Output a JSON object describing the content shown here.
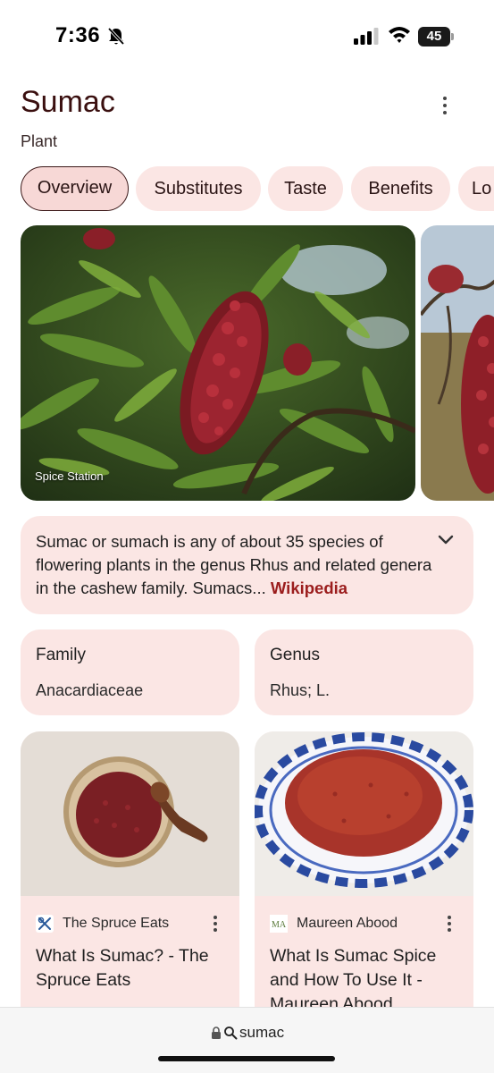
{
  "status_bar": {
    "time": "7:36",
    "battery": "45",
    "icons": [
      "bell-slash-icon",
      "signal-icon",
      "wifi-icon",
      "battery-icon"
    ]
  },
  "header": {
    "title": "Sumac",
    "subtitle": "Plant"
  },
  "tabs": [
    {
      "label": "Overview",
      "active": true
    },
    {
      "label": "Substitutes",
      "active": false
    },
    {
      "label": "Taste",
      "active": false
    },
    {
      "label": "Benefits",
      "active": false
    },
    {
      "label": "Lo",
      "active": false
    }
  ],
  "images": {
    "primary_caption": "Spice Station"
  },
  "description": {
    "text": "Sumac or sumach is any of about 35 species of flowering plants in the genus Rhus and related genera in the cashew family. Sumacs...",
    "source": "Wikipedia"
  },
  "facts": [
    {
      "label": "Family",
      "value": "Anacardiaceae"
    },
    {
      "label": "Genus",
      "value": "Rhus; L."
    }
  ],
  "articles": [
    {
      "source": "The Spruce Eats",
      "title": "What Is Sumac? - The Spruce Eats"
    },
    {
      "source": "Maureen Abood",
      "title": "What Is Sumac Spice and How To Use It - Maureen Abood",
      "source_icon_text": "MA"
    }
  ],
  "url_bar": {
    "query": "sumac"
  },
  "colors": {
    "accent_bg": "#fbe6e4",
    "title": "#3a0f0f",
    "link": "#9b1d1d"
  }
}
